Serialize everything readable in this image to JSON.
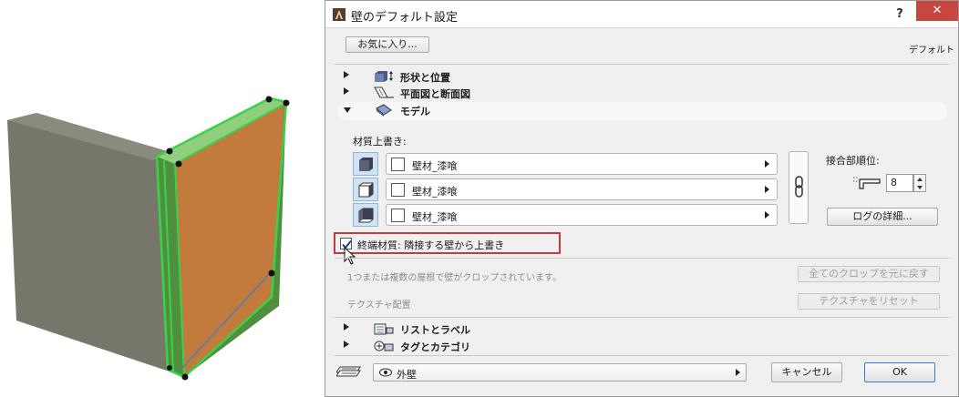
{
  "dialog": {
    "title": "壁のデフォルト設定",
    "help_label": "?",
    "close_label": "✕",
    "favorites_label": "お気に入り...",
    "default_label": "デフォルト"
  },
  "sections": {
    "shape": "形状と位置",
    "floor_plan": "平面図と断面図",
    "model": "モデル",
    "list_label": "リストとラベル",
    "tag_category": "タグとカテゴリ"
  },
  "model": {
    "material_override_label": "材質上書き:",
    "materials": [
      "壁材_漆喰",
      "壁材_漆喰",
      "壁材_漆喰"
    ],
    "junction_label": "接合部順位:",
    "junction_value": "8",
    "log_detail_label": "ログの詳細...",
    "end_material_label": "終端材質: 隣接する壁から上書き",
    "end_material_checked": true,
    "crop_note": "1つまたは複数の屋根で壁がクロップされています。",
    "reset_crop_label": "全てのクロップを元に戻す",
    "texture_label": "テクスチャ配置",
    "reset_texture_label": "テクスチャをリセット"
  },
  "footer": {
    "layer_value": "外壁",
    "cancel_label": "キャンセル",
    "ok_label": "OK"
  },
  "colors": {
    "close_button": "#c7463f",
    "highlight_border": "#c8393d",
    "selection_green": "#3bd14a",
    "wall_face": "#c27b3c"
  },
  "icons": {
    "app": "archicad-icon",
    "shape": "geometry-position-icon",
    "floor_plan": "floor-plan-section-icon",
    "model": "model-icon",
    "list_label": "list-label-icon",
    "tag_category": "tag-category-icon",
    "chain": "chain-link-icon",
    "junction": "junction-order-icon",
    "eye": "eye-icon",
    "sign": "layer-icon"
  }
}
